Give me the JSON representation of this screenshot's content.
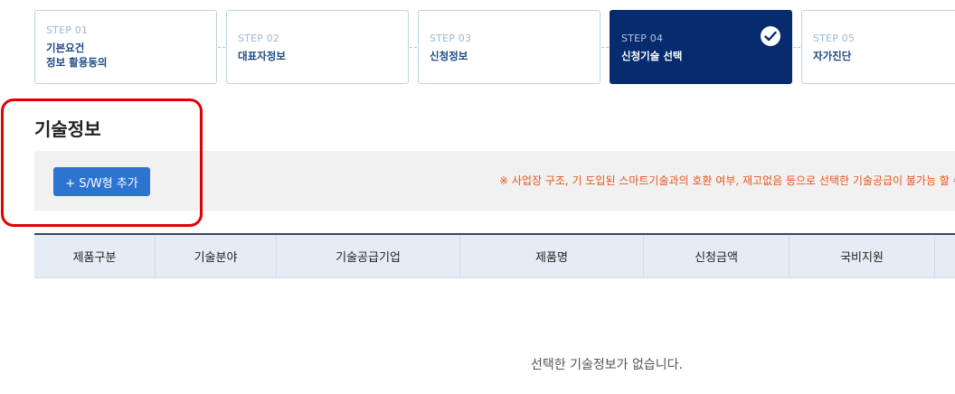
{
  "steps": [
    {
      "num": "STEP 01",
      "name": "기본요건\n정보 활용동의"
    },
    {
      "num": "STEP 02",
      "name": "대표자정보"
    },
    {
      "num": "STEP 03",
      "name": "신청정보"
    },
    {
      "num": "STEP 04",
      "name": "신청기술 선택",
      "active": true
    },
    {
      "num": "STEP 05",
      "name": "자가진단"
    }
  ],
  "section": {
    "title": "기술정보",
    "add_button": "+ S/W형 추가",
    "notice": "※ 사업장 구조, 기 도입된 스마트기술과의 호환 여부, 재고없음 등으로 선택한 기술공급이 불가능 할 수 있"
  },
  "table": {
    "headers": [
      "제품구분",
      "기술분야",
      "기술공급기업",
      "제품명",
      "신청금액",
      "국비지원"
    ],
    "empty_text": "선택한 기술정보가 없습니다."
  },
  "colors": {
    "active_step": "#062b6e",
    "button": "#2c74d0",
    "notice": "#e8551b",
    "highlight": "#e00000"
  },
  "icons": {
    "active_step": "check-icon"
  }
}
